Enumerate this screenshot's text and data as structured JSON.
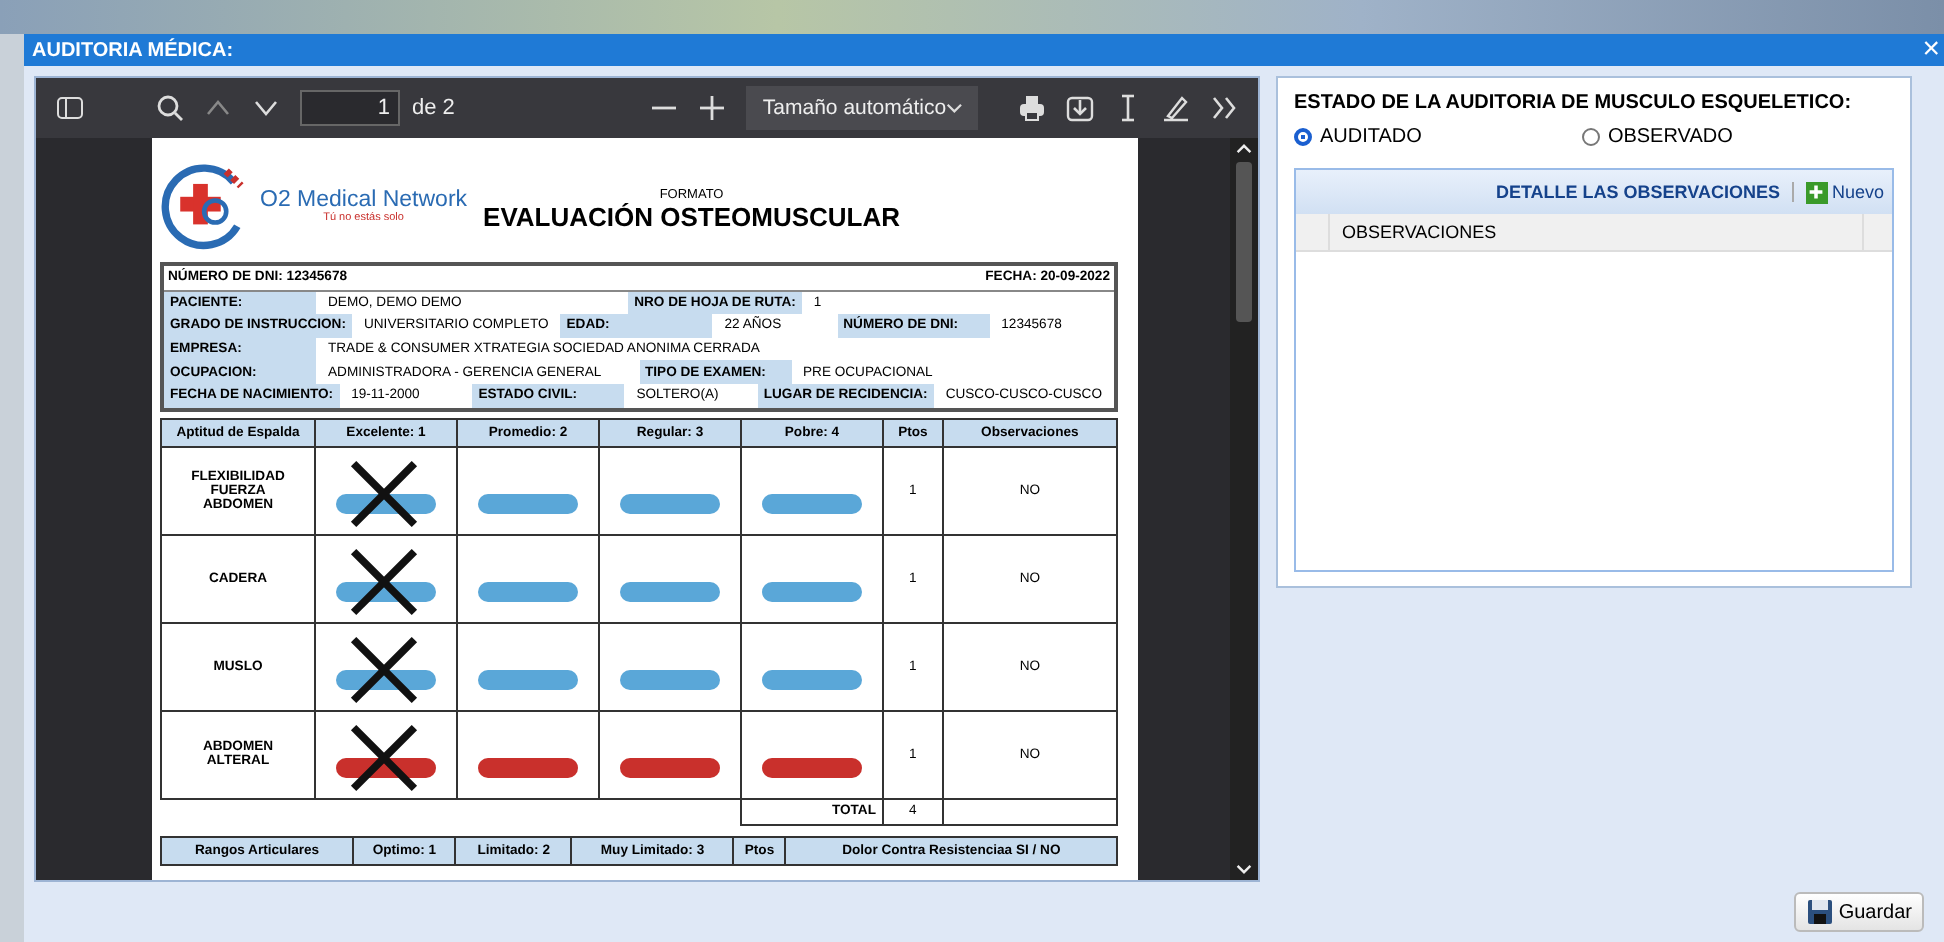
{
  "window": {
    "title": "AUDITORIA MÉDICA:",
    "close": "×"
  },
  "pdf_toolbar": {
    "page": "1",
    "page_count": "de 2",
    "zoom": "Tamaño automático"
  },
  "document": {
    "brand": "O2 Medical Network",
    "tagline": "Tú no estás solo",
    "subtitle": "FORMATO",
    "title": "EVALUACIÓN OSTEOMUSCULAR",
    "dni_line": "NÚMERO DE DNI: 12345678",
    "date_line": "FECHA: 20-09-2022",
    "info_rows": [
      [
        {
          "label": "PACIENTE:",
          "value": "DEMO, DEMO DEMO"
        },
        {
          "label": "NRO DE HOJA DE RUTA:",
          "value": "1"
        }
      ],
      [
        {
          "label": "GRADO DE INSTRUCCION:",
          "value": "UNIVERSITARIO COMPLETO"
        },
        {
          "label": "EDAD:",
          "value": "22 AÑOS"
        },
        {
          "label": "NÚMERO DE DNI:",
          "value": "12345678"
        }
      ],
      [
        {
          "label": "EMPRESA:",
          "value": "TRADE & CONSUMER XTRATEGIA SOCIEDAD ANONIMA CERRADA"
        }
      ],
      [
        {
          "label": "OCUPACION:",
          "value": "ADMINISTRADORA - GERENCIA GENERAL"
        },
        {
          "label": "TIPO DE EXAMEN:",
          "value": "PRE OCUPACIONAL"
        }
      ],
      [
        {
          "label": "FECHA DE NACIMIENTO:",
          "value": "19-11-2000"
        },
        {
          "label": "ESTADO CIVIL:",
          "value": "SOLTERO(A)"
        },
        {
          "label": "LUGAR DE RECIDENCIA:",
          "value": "CUSCO-CUSCO-CUSCO"
        }
      ]
    ],
    "exercise_table": {
      "columns": [
        "Aptitud de Espalda",
        "Excelente: 1",
        "Promedio: 2",
        "Regular: 3",
        "Pobre: 4",
        "Ptos",
        "Observaciones"
      ],
      "rows": [
        {
          "label": "FLEXIBILIDAD FUERZA ABDOMEN",
          "options": [
            {
              "crossed": true
            },
            {
              "crossed": false
            },
            {
              "crossed": false
            },
            {
              "crossed": false
            }
          ],
          "ptos": "1",
          "observaciones": "NO"
        },
        {
          "label": "CADERA",
          "options": [
            {
              "crossed": true
            },
            {
              "crossed": false
            },
            {
              "crossed": false
            },
            {
              "crossed": false
            }
          ],
          "ptos": "1",
          "observaciones": "NO"
        },
        {
          "label": "MUSLO",
          "options": [
            {
              "crossed": true
            },
            {
              "crossed": false
            },
            {
              "crossed": false
            },
            {
              "crossed": false
            }
          ],
          "ptos": "1",
          "observaciones": "NO"
        },
        {
          "label": "ABDOMEN ALTERAL",
          "options": [
            {
              "crossed": true
            },
            {
              "crossed": false
            },
            {
              "crossed": false
            },
            {
              "crossed": false
            }
          ],
          "ptos": "1",
          "observaciones": "NO"
        }
      ],
      "total_label": "TOTAL",
      "total": "4"
    },
    "ranges_table": {
      "columns": [
        "Rangos Articulares",
        "Optimo: 1",
        "Limitado: 2",
        "Muy Limitado: 3",
        "Ptos",
        "Dolor Contra Resistenciaa SI / NO"
      ]
    }
  },
  "audit": {
    "heading": "ESTADO DE LA AUDITORIA DE MUSCULO ESQUELETICO:",
    "options": [
      {
        "label": "AUDITADO",
        "selected": true
      },
      {
        "label": "OBSERVADO",
        "selected": false
      }
    ],
    "grid": {
      "title": "DETALLE LAS OBSERVACIONES",
      "new_button": "Nuevo",
      "columns": [
        "OBSERVACIONES"
      ]
    }
  },
  "footer": {
    "save_button": "Guardar"
  }
}
